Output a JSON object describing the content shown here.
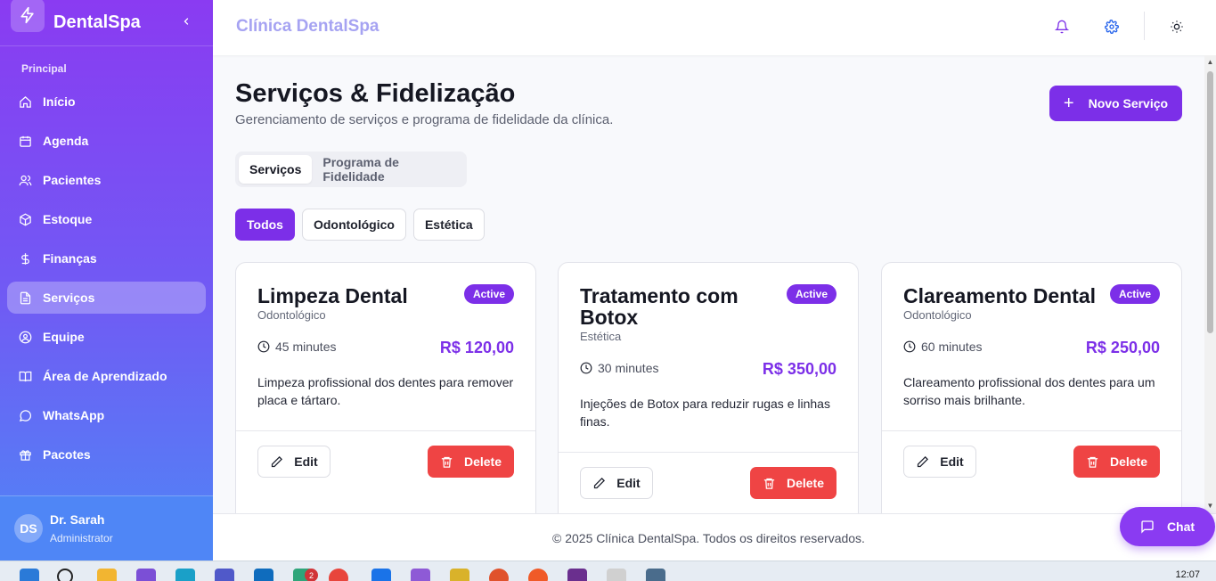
{
  "brand": {
    "name": "DentalSpa",
    "logo_icon": "lightning-icon",
    "collapse_icon": "chevron-left-icon"
  },
  "sidebar": {
    "section_label": "Principal",
    "items": [
      {
        "label": "Início",
        "icon": "home-icon"
      },
      {
        "label": "Agenda",
        "icon": "calendar-icon"
      },
      {
        "label": "Pacientes",
        "icon": "users-icon"
      },
      {
        "label": "Estoque",
        "icon": "box-icon"
      },
      {
        "label": "Finanças",
        "icon": "dollar-icon"
      },
      {
        "label": "Serviços",
        "icon": "document-icon",
        "active": true
      },
      {
        "label": "Equipe",
        "icon": "user-circle-icon"
      },
      {
        "label": "Área de Aprendizado",
        "icon": "book-icon"
      },
      {
        "label": "WhatsApp",
        "icon": "whatsapp-icon"
      },
      {
        "label": "Pacotes",
        "icon": "gift-icon"
      }
    ],
    "user": {
      "initials": "DS",
      "name": "Dr. Sarah",
      "role": "Administrator"
    }
  },
  "header": {
    "title": "Clínica DentalSpa",
    "icons": [
      "bell-icon",
      "gear-icon",
      "sun-icon"
    ]
  },
  "page": {
    "title": "Serviços & Fidelização",
    "subtitle": "Gerenciamento de serviços e programa de fidelidade da clínica.",
    "new_button": "Novo Serviço",
    "tabs": [
      {
        "label": "Serviços",
        "active": true
      },
      {
        "label": "Programa de Fidelidade",
        "active": false
      }
    ],
    "filters": [
      {
        "label": "Todos",
        "active": true
      },
      {
        "label": "Odontológico",
        "active": false
      },
      {
        "label": "Estética",
        "active": false
      }
    ]
  },
  "services": [
    {
      "name": "Limpeza Dental",
      "category": "Odontológico",
      "status": "Active",
      "duration": "45 minutes",
      "price": "R$ 120,00",
      "description": "Limpeza profissional dos dentes para remover placa e tártaro.",
      "edit_label": "Edit",
      "delete_label": "Delete"
    },
    {
      "name": "Tratamento com Botox",
      "category": "Estética",
      "status": "Active",
      "duration": "30 minutes",
      "price": "R$ 350,00",
      "description": "Injeções de Botox para reduzir rugas e linhas finas.",
      "edit_label": "Edit",
      "delete_label": "Delete"
    },
    {
      "name": "Clareamento Dental",
      "category": "Odontológico",
      "status": "Active",
      "duration": "60 minutes",
      "price": "R$ 250,00",
      "description": "Clareamento profissional dos dentes para um sorriso mais brilhante.",
      "edit_label": "Edit",
      "delete_label": "Delete"
    }
  ],
  "footer": {
    "text": "© 2025 Clínica DentalSpa. Todos os direitos reservados."
  },
  "chat": {
    "label": "Chat"
  },
  "taskbar": {
    "clock": "12:07",
    "notification_count": "2"
  },
  "colors": {
    "accent": "#7c2fe8",
    "danger": "#ef4444",
    "sidebar_top": "#8a3bf2",
    "sidebar_bottom": "#4f86f6"
  }
}
